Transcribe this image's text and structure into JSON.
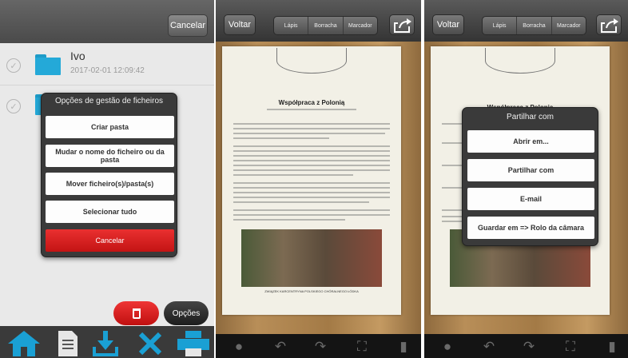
{
  "files_screen": {
    "cancel_label": "Cancelar",
    "files": [
      {
        "name": "Ivo",
        "date": "2017-02-01 12:09:42"
      }
    ],
    "dialog": {
      "title": "Opções de gestão de ficheiros",
      "options": [
        "Criar pasta",
        "Mudar o nome do ficheiro ou da pasta",
        "Mover ficheiro(s)/pasta(s)",
        "Selecionar tudo"
      ],
      "cancel_label": "Cancelar"
    },
    "options_label": "Opções",
    "bottom_icons": [
      "home-icon",
      "document-icon",
      "download-icon",
      "tools-icon",
      "printer-icon"
    ],
    "accent_color": "#24a9d8",
    "danger_color": "#d62020"
  },
  "scan_screen": {
    "back_label": "Voltar",
    "tools": [
      "Lápis",
      "Borracha",
      "Marcador"
    ],
    "document_title": "Współpraca z Polonią",
    "document_footer": "ZWIĄZEK KARCENTRYNA POLSKIEGO CHÓRALNEGO ŁÓDKA",
    "bottom_icons": [
      "chat-icon",
      "undo-icon",
      "redo-icon",
      "crop-icon",
      "trash-icon"
    ]
  },
  "share_screen": {
    "back_label": "Voltar",
    "tools": [
      "Lápis",
      "Borracha",
      "Marcador"
    ],
    "document_title": "Współpraca z Polonią",
    "dialog": {
      "title": "Partilhar com",
      "options": [
        "Abrir em...",
        "Partilhar com",
        "E-mail",
        "Guardar em => Rolo da câmara"
      ]
    }
  }
}
